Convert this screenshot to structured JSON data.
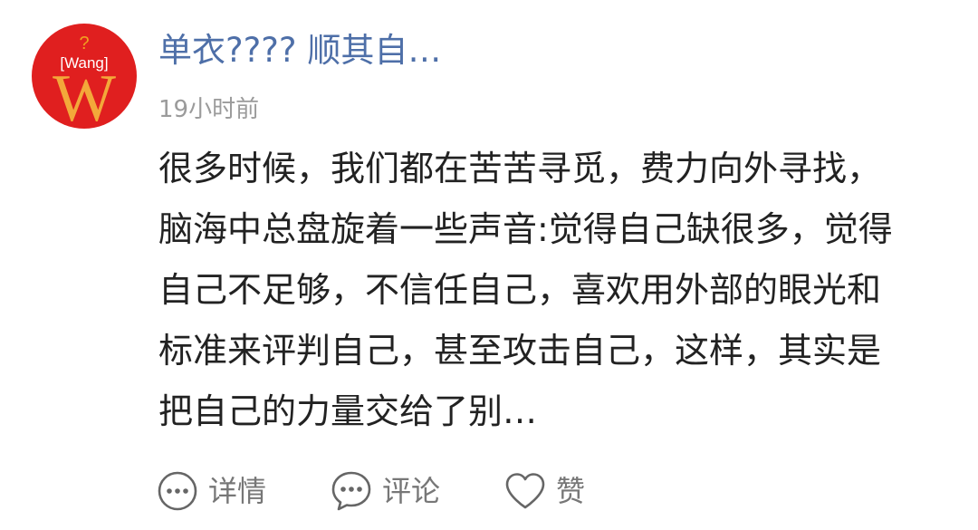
{
  "post": {
    "avatar": {
      "mark": "?",
      "tag": "[Wang]",
      "letter": "W",
      "color": "#e01f1f"
    },
    "author": "单衣???? 顺其自…",
    "time": "19小时前",
    "content": "很多时候，我们都在苦苦寻觅，费力向外寻找，脑海中总盘旋着一些声音:觉得自己缺很多，觉得自己不足够，不信任自己，喜欢用外部的眼光和标准来评判自己，甚至攻击自己，这样，其实是把自己的力量交给了别…"
  },
  "actions": {
    "details": {
      "label": "详情",
      "icon": "more-dots-icon"
    },
    "comment": {
      "label": "评论",
      "icon": "comment-bubble-icon"
    },
    "like": {
      "label": "赞",
      "icon": "heart-icon"
    }
  },
  "colors": {
    "author": "#4e6fa8",
    "time": "#9b9b9b",
    "text": "#222222",
    "action_label": "#777777"
  }
}
